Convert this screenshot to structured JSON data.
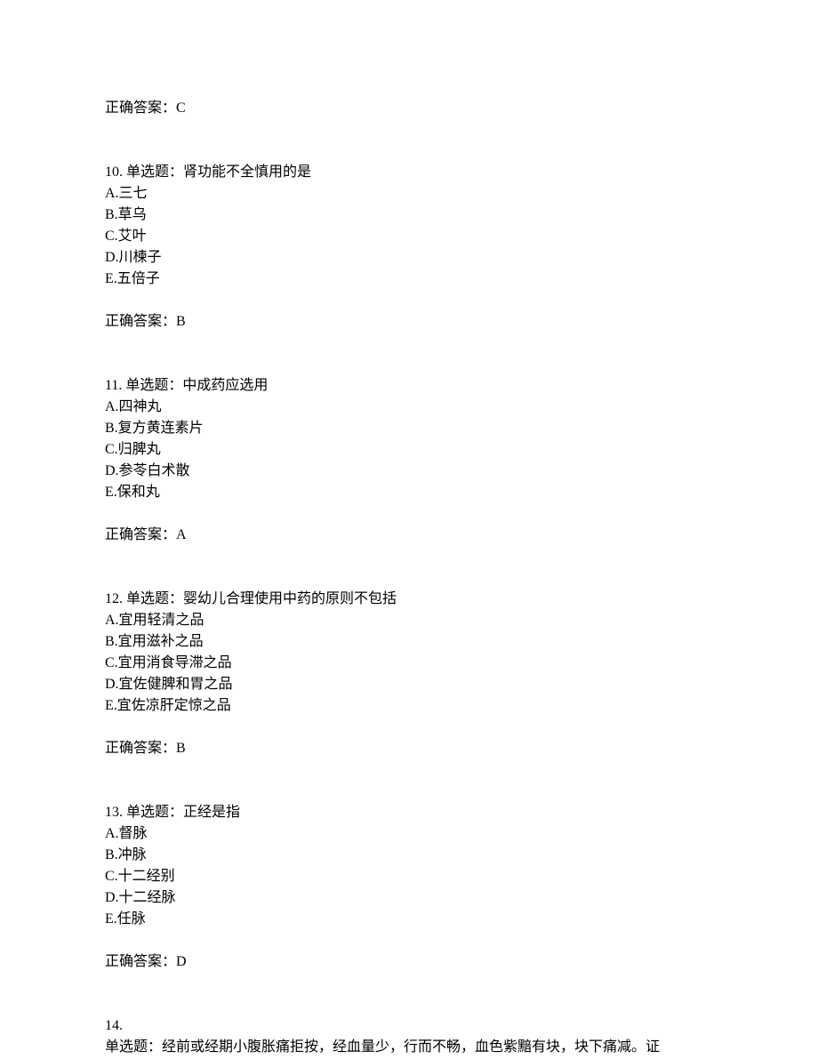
{
  "prev_answer": "正确答案：C",
  "questions": [
    {
      "number": "10.",
      "type": "单选题：",
      "stem": "肾功能不全慎用的是",
      "options": [
        "A.三七",
        "B.草乌",
        "C.艾叶",
        "D.川楝子",
        "E.五倍子"
      ],
      "answer": "正确答案：B"
    },
    {
      "number": "11.",
      "type": "单选题：",
      "stem": "中成药应选用",
      "options": [
        "A.四神丸",
        "B.复方黄连素片",
        "C.归脾丸",
        "D.参苓白术散",
        "E.保和丸"
      ],
      "answer": "正确答案：A"
    },
    {
      "number": "12.",
      "type": "单选题：",
      "stem": "婴幼儿合理使用中药的原则不包括",
      "options": [
        "A.宜用轻清之品",
        "B.宜用滋补之品",
        "C.宜用消食导滞之品",
        "D.宜佐健脾和胃之品",
        "E.宜佐凉肝定惊之品"
      ],
      "answer": "正确答案：B"
    },
    {
      "number": "13.",
      "type": "单选题：",
      "stem": "正经是指",
      "options": [
        "A.督脉",
        "B.冲脉",
        "C.十二经别",
        "D.十二经脉",
        "E.任脉"
      ],
      "answer": "正确答案：D"
    }
  ],
  "q14": {
    "number": "14.",
    "line2_prefix": "单选题：",
    "line2_text": "经前或经期小腹胀痛拒按，经血量少，行而不畅，血色紫黯有块，块下痛减。证"
  }
}
